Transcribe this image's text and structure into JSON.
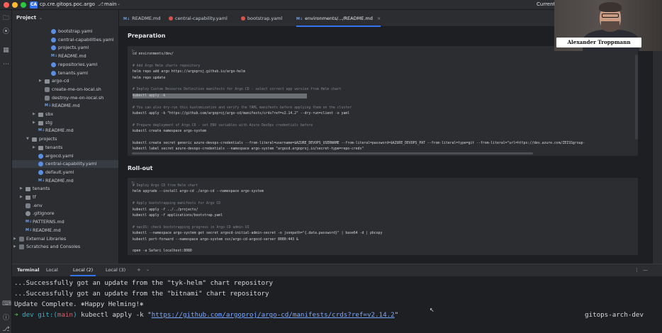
{
  "titlebar": {
    "project_badge": "CA",
    "project_name": "cp.cre.gitops.poc.argo",
    "branch": "main",
    "current_label": "Current"
  },
  "project_panel": {
    "title": "Project",
    "items": [
      {
        "name": "bootstrap.yaml",
        "type": "yaml",
        "level": 5
      },
      {
        "name": "central-capabilities.yaml",
        "type": "yaml",
        "level": 5
      },
      {
        "name": "projects.yaml",
        "type": "yaml",
        "level": 5
      },
      {
        "name": "README.md",
        "type": "md",
        "level": 5
      },
      {
        "name": "repositories.yaml",
        "type": "yaml",
        "level": 5
      },
      {
        "name": "tenants.yaml",
        "type": "yaml",
        "level": 5
      },
      {
        "name": "argo-cd",
        "type": "folder",
        "level": 4,
        "collapsed": true
      },
      {
        "name": "create-me-on-local.sh",
        "type": "sh",
        "level": 4
      },
      {
        "name": "destroy-me-on-local.sh",
        "type": "sh",
        "level": 4
      },
      {
        "name": "README.md",
        "type": "md",
        "level": 4
      },
      {
        "name": "sbx",
        "type": "folder",
        "level": 3,
        "collapsed": true
      },
      {
        "name": "stg",
        "type": "folder",
        "level": 3,
        "collapsed": true
      },
      {
        "name": "README.md",
        "type": "md",
        "level": 3
      },
      {
        "name": "projects",
        "type": "folder",
        "level": 2,
        "collapsed": false
      },
      {
        "name": "tenants",
        "type": "folder",
        "level": 3,
        "collapsed": true
      },
      {
        "name": "argocd.yaml",
        "type": "yaml",
        "level": 3
      },
      {
        "name": "central-capability.yaml",
        "type": "yaml",
        "level": 3,
        "selected": true
      },
      {
        "name": "default.yaml",
        "type": "yaml",
        "level": 3
      },
      {
        "name": "README.md",
        "type": "md",
        "level": 3
      },
      {
        "name": "tenants",
        "type": "folder",
        "level": 1,
        "collapsed": true
      },
      {
        "name": "tf",
        "type": "folder",
        "level": 1,
        "collapsed": true
      },
      {
        "name": ".env",
        "type": "env",
        "level": 1
      },
      {
        "name": ".gitignore",
        "type": "git",
        "level": 1
      },
      {
        "name": "PATTERNS.md",
        "type": "md",
        "level": 1
      },
      {
        "name": "README.md",
        "type": "md",
        "level": 1
      },
      {
        "name": "External Libraries",
        "type": "lib",
        "level": 0,
        "collapsed": true
      },
      {
        "name": "Scratches and Consoles",
        "type": "scratch",
        "level": 0,
        "collapsed": true
      }
    ]
  },
  "tabs": [
    {
      "label": "README.md",
      "icon": "md"
    },
    {
      "label": "central-capability.yaml",
      "icon": "yaml"
    },
    {
      "label": "bootstrap.yaml",
      "icon": "yaml"
    },
    {
      "label": "environments/.../README.md",
      "icon": "md",
      "active": true
    }
  ],
  "sections": [
    {
      "title": "Preparation",
      "lines": [
        {
          "text": "cd environments/dev/",
          "kind": "code"
        },
        {
          "text": "",
          "kind": "blank"
        },
        {
          "text": "# Add Argo Helm charts repository",
          "kind": "comment"
        },
        {
          "text": "helm repo add argo https://argoproj.github.io/argo-helm",
          "kind": "code"
        },
        {
          "text": "helm repo update",
          "kind": "code"
        },
        {
          "text": "",
          "kind": "blank"
        },
        {
          "text": "# Deploy Custom Resource Definition manifests for Argo CD - select correct app version from Helm chart",
          "kind": "comment"
        },
        {
          "text": "kubectl apply -k",
          "kind": "highlight"
        },
        {
          "text": "",
          "kind": "blank"
        },
        {
          "text": "# You can also dry-run this kustomization and verify the YAML manifests before applying them on the cluster",
          "kind": "comment"
        },
        {
          "text": "kubectl apply -k \"https://github.com/argoproj/argo-cd/manifests/crds?ref=v2.14.2\" --dry-run=client -o yaml",
          "kind": "code"
        },
        {
          "text": "",
          "kind": "blank"
        },
        {
          "text": "# Prepare deployment of Argo CD - set ENV variables with Azure DevOps credentials before",
          "kind": "comment"
        },
        {
          "text": "kubectl create namespace argo-system",
          "kind": "code"
        },
        {
          "text": "",
          "kind": "blank"
        },
        {
          "text": "kubectl create secret generic azure-devops-credentials --from-literal=username=$AZURE_DEVOPS_USERNAME --from-literal=password=$AZURE_DEVOPS_PAT --from-literal=type=git --from-literal=\"url=https://dev.azure.com/ZEISSgroup-",
          "kind": "code"
        },
        {
          "text": "kubectl label secret azure-devops-credentials --namespace argo-system \"argocd.argoproj.io/secret-type=repo-creds\"",
          "kind": "code"
        }
      ]
    },
    {
      "title": "Roll-out",
      "lines": [
        {
          "text": "# Deploy Argo CD from Helm chart",
          "kind": "comment"
        },
        {
          "text": "helm upgrade --install argo-cd ./argo-cd --namespace argo-system",
          "kind": "code"
        },
        {
          "text": "",
          "kind": "blank"
        },
        {
          "text": "# Apply bootstrapping manifests for Argo CD",
          "kind": "comment"
        },
        {
          "text": "kubectl apply -f ../../projects/",
          "kind": "code"
        },
        {
          "text": "kubectl apply -f applications/bootstrap.yaml",
          "kind": "code"
        },
        {
          "text": "",
          "kind": "blank"
        },
        {
          "text": "# macOS: check bootstrapping progress in Argo CD admin UI",
          "kind": "comment"
        },
        {
          "text": "kubectl --namespace argo-system get secret argocd-initial-admin-secret -o jsonpath=\"{.data.password}\" | base64 -d | pbcopy",
          "kind": "code"
        },
        {
          "text": "kubectl port-forward --namespace argo-system svc/argo-cd-argocd-server 8080:443 &",
          "kind": "code"
        },
        {
          "text": "",
          "kind": "blank"
        },
        {
          "text": "open -a Safari localhost:8080",
          "kind": "code"
        }
      ]
    }
  ],
  "webcam": {
    "name": "Alexander Troppmann"
  },
  "terminal": {
    "label": "Terminal",
    "tabs": [
      {
        "label": "Local"
      },
      {
        "label": "Local (2)",
        "active": true
      },
      {
        "label": "Local (3)"
      }
    ],
    "add_label": "+",
    "lines": [
      "...Successfully got an update from the \"tyk-helm\" chart repository",
      "...Successfully got an update from the \"bitnami\" chart repository",
      "Update Complete. ⎈Happy Helming!⎈"
    ],
    "prompt": {
      "arrow": "➜",
      "dir": "dev",
      "git": "git:(",
      "branch": "main",
      "git_close": ")",
      "cmd": " kubectl apply -k \"",
      "url": "https://github.com/argoproj/argo-cd/manifests/crds?ref=v2.14.2",
      "tail": "\""
    },
    "right_label": "gitops-arch-dev"
  },
  "colors": {
    "accent": "#3574f0",
    "bg_editor": "#1e1f22",
    "bg_panel": "#2b2d30"
  }
}
